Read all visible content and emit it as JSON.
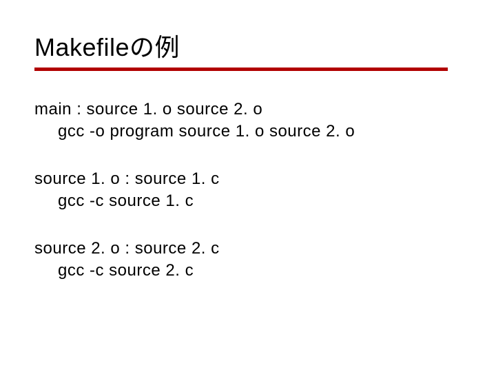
{
  "title": "Makefileの例",
  "rules": [
    {
      "target": "main : source 1. o source 2. o",
      "command": "gcc -o program source 1. o source 2. o"
    },
    {
      "target": "source 1. o : source 1. c",
      "command": "gcc -c source 1. c"
    },
    {
      "target": "source 2. o : source 2. c",
      "command": "gcc -c source 2. c"
    }
  ]
}
